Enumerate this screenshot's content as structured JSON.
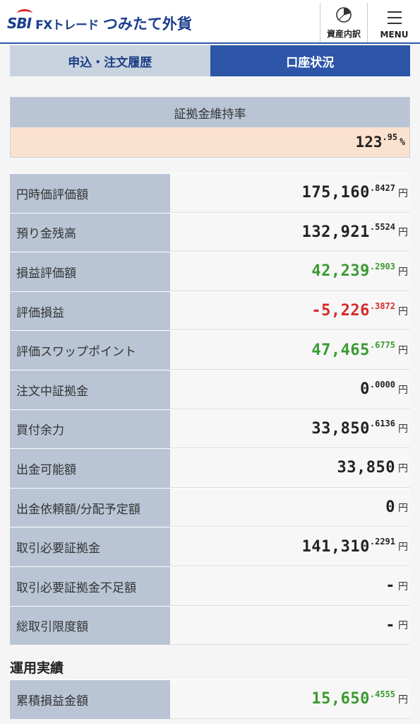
{
  "header": {
    "logo": {
      "brand": "SBI",
      "fx": "FXトレード",
      "product": "つみたて外貨"
    },
    "assets_label": "資産内訳",
    "assets_icon": "pie-chart-icon",
    "menu_label": "MENU",
    "menu_icon": "hamburger-icon"
  },
  "tabs": [
    {
      "label": "申込・注文履歴",
      "active": false
    },
    {
      "label": "口座状況",
      "active": true
    }
  ],
  "ratio": {
    "title": "証拠金維持率",
    "int": "123",
    "dec": ".95",
    "unit": "%"
  },
  "rows": [
    {
      "label": "円時価評価額",
      "int": "175,160",
      "dec": ".8427",
      "unit": "円",
      "tone": "neu"
    },
    {
      "label": "預り金残高",
      "int": "132,921",
      "dec": ".5524",
      "unit": "円",
      "tone": "neu"
    },
    {
      "label": "損益評価額",
      "int": "42,239",
      "dec": ".2903",
      "unit": "円",
      "tone": "pos"
    },
    {
      "label": "評価損益",
      "int": "-5,226",
      "dec": ".3872",
      "unit": "円",
      "tone": "neg"
    },
    {
      "label": "評価スワップポイント",
      "int": "47,465",
      "dec": ".6775",
      "unit": "円",
      "tone": "pos"
    },
    {
      "label": "注文中証拠金",
      "int": "0",
      "dec": ".0000",
      "unit": "円",
      "tone": "neu"
    },
    {
      "label": "買付余力",
      "int": "33,850",
      "dec": ".6136",
      "unit": "円",
      "tone": "neu"
    },
    {
      "label": "出金可能額",
      "int": "33,850",
      "dec": "",
      "unit": "円",
      "tone": "neu"
    },
    {
      "label": "出金依頼額/分配予定額",
      "int": "0",
      "dec": "",
      "unit": "円",
      "tone": "neu"
    },
    {
      "label": "取引必要証拠金",
      "int": "141,310",
      "dec": ".2291",
      "unit": "円",
      "tone": "neu"
    },
    {
      "label": "取引必要証拠金不足額",
      "int": "-",
      "dec": "",
      "unit": "円",
      "tone": "neu"
    },
    {
      "label": "総取引限度額",
      "int": "-",
      "dec": "",
      "unit": "円",
      "tone": "neu"
    }
  ],
  "performance": {
    "title": "運用実績",
    "rows": [
      {
        "label": "累積損益金額",
        "int": "15,650",
        "dec": ".4555",
        "unit": "円",
        "tone": "pos"
      }
    ]
  },
  "colors": {
    "accent": "#2d56a8",
    "positive": "#3a9a31",
    "negative": "#d52a2a"
  }
}
